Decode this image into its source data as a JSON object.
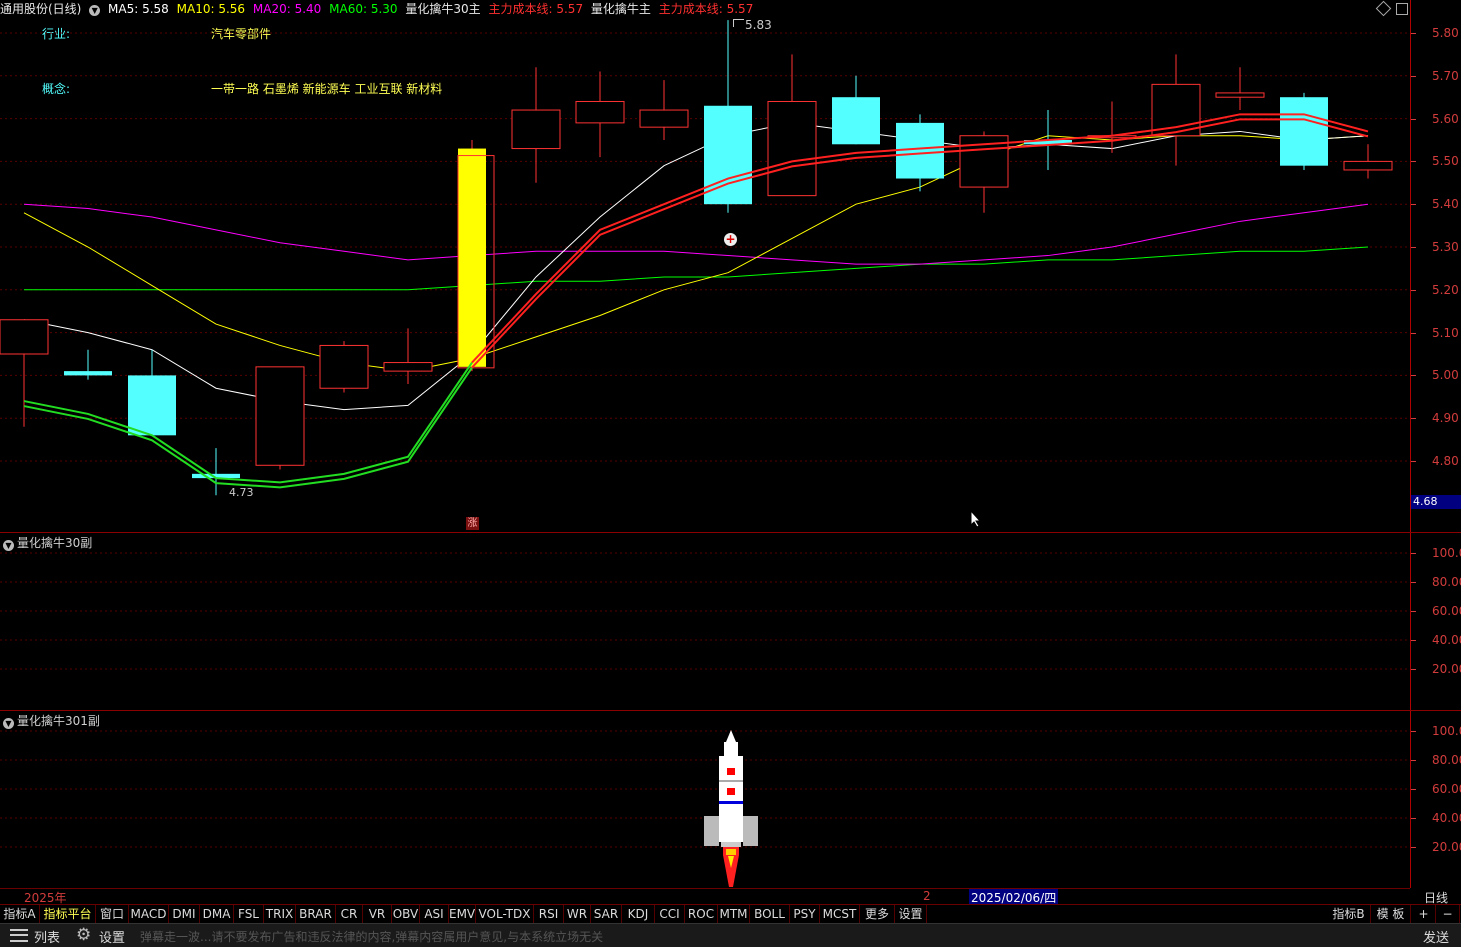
{
  "header": {
    "stock": "通用股份(日线)",
    "ma5": "MA5: 5.58",
    "ma10": "MA10: 5.56",
    "ma20": "MA20: 5.40",
    "ma60": "MA60: 5.30",
    "indicator_main": "量化擒牛30主",
    "cost_line_1": "主力成本线: 5.57",
    "indicator_main_2": "量化擒牛主",
    "cost_line_2": "主力成本线: 5.57"
  },
  "info": {
    "industry_label": "行业:",
    "industry_value": "汽车零部件",
    "concept_label": "概念:",
    "concept_value": "一带一路 石墨烯 新能源车 工业互联 新材料"
  },
  "annotations": {
    "high_label": "5.83",
    "low_label": "4.73",
    "limit_up_marker": "涨",
    "current_price_tag": "4.68"
  },
  "colors": {
    "up": "#ff3232",
    "down": "#54ffff",
    "limit_up": "#ffff00",
    "ma5": "#ffffff",
    "ma10": "#ffff00",
    "ma20": "#ff00ff",
    "ma60": "#00ff00",
    "cost_up": "#ff2020",
    "cost_down": "#22dd22"
  },
  "main_axis": {
    "ticks": [
      "5.80",
      "5.70",
      "5.60",
      "5.50",
      "5.40",
      "5.30",
      "5.20",
      "5.10",
      "5.00",
      "4.90",
      "4.80"
    ]
  },
  "sub1": {
    "title": "量化擒牛30副",
    "ticks": [
      "100.0",
      "80.00",
      "60.00",
      "40.00",
      "20.00"
    ]
  },
  "sub2": {
    "title": "量化擒牛301副",
    "ticks": [
      "100.0",
      "80.00",
      "60.00",
      "40.00",
      "20.00"
    ]
  },
  "datebar": {
    "year": "2025年",
    "month": "2",
    "cursor_date": "2025/02/06/四",
    "period": "日线"
  },
  "tabs": [
    "指标A",
    "指标平台",
    "窗口",
    "MACD",
    "DMI",
    "DMA",
    "FSL",
    "TRIX",
    "BRAR",
    "CR",
    "VR",
    "OBV",
    "ASI",
    "EMV",
    "VOL-TDX",
    "RSI",
    "WR",
    "SAR",
    "KDJ",
    "CCI",
    "ROC",
    "MTM",
    "BOLL",
    "PSY",
    "MCST",
    "更多",
    "设置"
  ],
  "tabs_right": [
    "指标B",
    "模 板",
    "+",
    "−"
  ],
  "statusbar": {
    "list_label": "列表",
    "settings_label": "设置",
    "danmaku_placeholder": "弹幕走一波...请不要发布广告和违反法律的内容,弹幕内容属用户意见,与本系统立场无关",
    "send_label": "发送"
  },
  "chart_data": {
    "type": "candlestick",
    "ylim": [
      4.66,
      5.86
    ],
    "candles": [
      {
        "o": 5.05,
        "h": 5.13,
        "l": 4.88,
        "c": 5.13
      },
      {
        "o": 5.01,
        "h": 5.06,
        "l": 4.99,
        "c": 5.0
      },
      {
        "o": 5.0,
        "h": 5.06,
        "l": 4.86,
        "c": 4.86
      },
      {
        "o": 4.77,
        "h": 4.83,
        "l": 4.72,
        "c": 4.76
      },
      {
        "o": 4.79,
        "h": 5.02,
        "l": 4.78,
        "c": 5.02
      },
      {
        "o": 4.97,
        "h": 5.08,
        "l": 4.96,
        "c": 5.07
      },
      {
        "o": 5.01,
        "h": 5.11,
        "l": 4.98,
        "c": 5.03
      },
      {
        "o": 5.53,
        "h": 5.55,
        "l": 5.01,
        "c": 5.02,
        "limit": true
      },
      {
        "o": 5.53,
        "h": 5.72,
        "l": 5.45,
        "c": 5.62
      },
      {
        "o": 5.59,
        "h": 5.71,
        "l": 5.51,
        "c": 5.64
      },
      {
        "o": 5.58,
        "h": 5.69,
        "l": 5.55,
        "c": 5.62
      },
      {
        "o": 5.63,
        "h": 5.83,
        "l": 5.38,
        "c": 5.4
      },
      {
        "o": 5.42,
        "h": 5.75,
        "l": 5.42,
        "c": 5.64
      },
      {
        "o": 5.65,
        "h": 5.7,
        "l": 5.54,
        "c": 5.54
      },
      {
        "o": 5.59,
        "h": 5.61,
        "l": 5.43,
        "c": 5.46
      },
      {
        "o": 5.44,
        "h": 5.57,
        "l": 5.38,
        "c": 5.56
      },
      {
        "o": 5.55,
        "h": 5.62,
        "l": 5.48,
        "c": 5.54
      },
      {
        "o": 5.56,
        "h": 5.64,
        "l": 5.52,
        "c": 5.56
      },
      {
        "o": 5.56,
        "h": 5.75,
        "l": 5.49,
        "c": 5.68
      },
      {
        "o": 5.65,
        "h": 5.72,
        "l": 5.62,
        "c": 5.66
      },
      {
        "o": 5.65,
        "h": 5.66,
        "l": 5.48,
        "c": 5.49
      },
      {
        "o": 5.48,
        "h": 5.54,
        "l": 5.46,
        "c": 5.5
      }
    ],
    "ma5": [
      5.13,
      5.1,
      5.06,
      4.97,
      4.94,
      4.92,
      4.93,
      5.05,
      5.23,
      5.37,
      5.49,
      5.56,
      5.59,
      5.57,
      5.55,
      5.53,
      5.54,
      5.53,
      5.56,
      5.57,
      5.55,
      5.56
    ],
    "ma10": [
      5.38,
      5.3,
      5.21,
      5.12,
      5.07,
      5.03,
      5.01,
      5.04,
      5.09,
      5.14,
      5.2,
      5.24,
      5.32,
      5.4,
      5.44,
      5.51,
      5.56,
      5.55,
      5.56,
      5.56,
      5.55,
      5.56
    ],
    "ma20": [
      5.4,
      5.39,
      5.37,
      5.34,
      5.31,
      5.29,
      5.27,
      5.28,
      5.29,
      5.29,
      5.29,
      5.28,
      5.27,
      5.26,
      5.26,
      5.27,
      5.28,
      5.3,
      5.33,
      5.36,
      5.38,
      5.4
    ],
    "ma60": [
      5.2,
      5.2,
      5.2,
      5.2,
      5.2,
      5.2,
      5.2,
      5.21,
      5.22,
      5.22,
      5.23,
      5.23,
      5.24,
      5.25,
      5.26,
      5.26,
      5.27,
      5.27,
      5.28,
      5.29,
      5.29,
      5.3
    ],
    "cost": [
      4.94,
      4.91,
      4.86,
      4.76,
      4.75,
      4.77,
      4.81,
      5.03,
      5.19,
      5.34,
      5.4,
      5.46,
      5.5,
      5.52,
      5.53,
      5.54,
      5.55,
      5.56,
      5.58,
      5.61,
      5.61,
      5.57
    ]
  }
}
